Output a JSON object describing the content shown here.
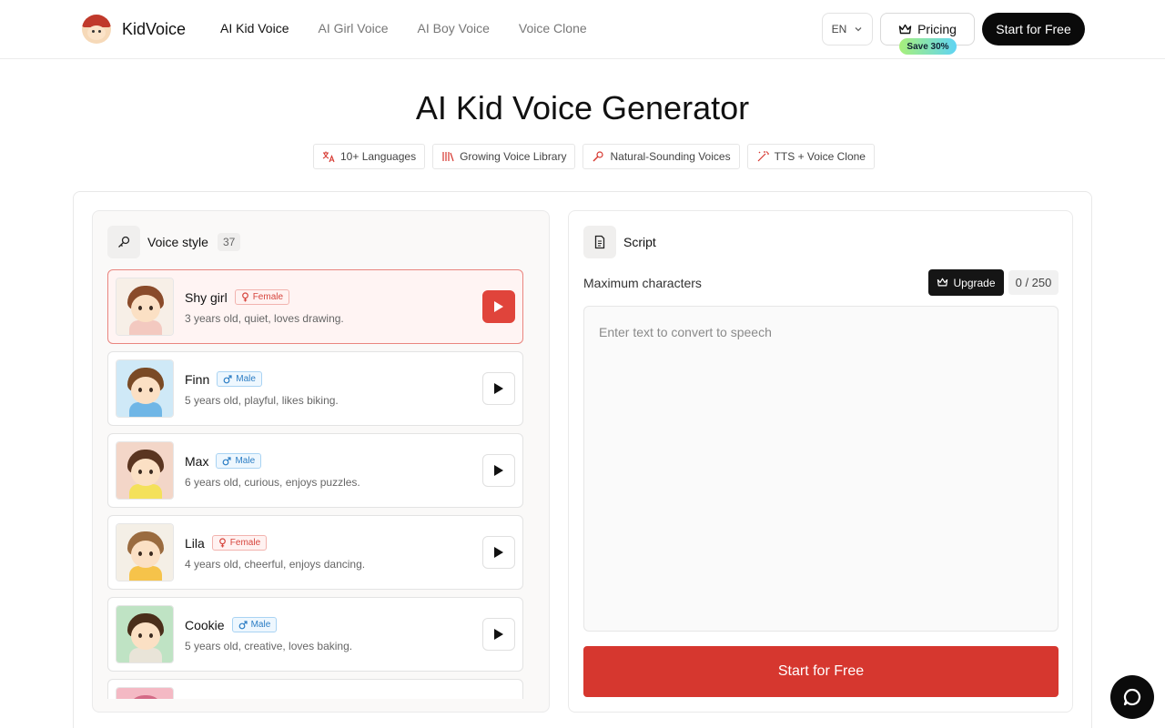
{
  "header": {
    "logo_text": "KidVoice",
    "nav": [
      {
        "label": "AI Kid Voice",
        "active": true
      },
      {
        "label": "AI Girl Voice",
        "active": false
      },
      {
        "label": "AI Boy Voice",
        "active": false
      },
      {
        "label": "Voice Clone",
        "active": false
      }
    ],
    "language": "EN",
    "pricing_label": "Pricing",
    "save_badge": "Save 30%",
    "start_label": "Start for Free"
  },
  "hero": {
    "title": "AI Kid Voice Generator",
    "features": [
      {
        "icon": "translate-icon",
        "label": "10+ Languages"
      },
      {
        "icon": "library-icon",
        "label": "Growing Voice Library"
      },
      {
        "icon": "microphone-icon",
        "label": "Natural-Sounding Voices"
      },
      {
        "icon": "magic-wand-icon",
        "label": "TTS + Voice Clone"
      }
    ]
  },
  "voice_panel": {
    "title": "Voice style",
    "count": "37",
    "voices": [
      {
        "name": "Shy girl",
        "gender": "Female",
        "desc": "3 years old, quiet, loves drawing.",
        "selected": true,
        "bg": "#f7efe7",
        "hair": "#8a4b2a",
        "body": "#f3c9c0"
      },
      {
        "name": "Finn",
        "gender": "Male",
        "desc": "5 years old, playful, likes biking.",
        "selected": false,
        "bg": "#cfe9f7",
        "hair": "#7a4a25",
        "body": "#6fb6e6"
      },
      {
        "name": "Max",
        "gender": "Male",
        "desc": "6 years old, curious, enjoys puzzles.",
        "selected": false,
        "bg": "#f3d6c8",
        "hair": "#5a3520",
        "body": "#f4e15a"
      },
      {
        "name": "Lila",
        "gender": "Female",
        "desc": "4 years old, cheerful, enjoys dancing.",
        "selected": false,
        "bg": "#f4efe6",
        "hair": "#9a6b3f",
        "body": "#f6c34a"
      },
      {
        "name": "Cookie",
        "gender": "Male",
        "desc": "5 years old, creative, loves baking.",
        "selected": false,
        "bg": "#bfe3c4",
        "hair": "#4a2e1a",
        "body": "#e9e4d8"
      },
      {
        "name": "",
        "gender": "",
        "desc": "",
        "selected": false,
        "bg": "#f4b9c4",
        "hair": "#d46a86",
        "body": "#f4b9c4"
      }
    ]
  },
  "script_panel": {
    "title": "Script",
    "max_label": "Maximum characters",
    "upgrade_label": "Upgrade",
    "char_count": "0 / 250",
    "placeholder": "Enter text to convert to speech",
    "start_label": "Start for Free"
  },
  "colors": {
    "accent": "#d6372f",
    "female": "#d6453d",
    "male": "#2b7dc4"
  }
}
